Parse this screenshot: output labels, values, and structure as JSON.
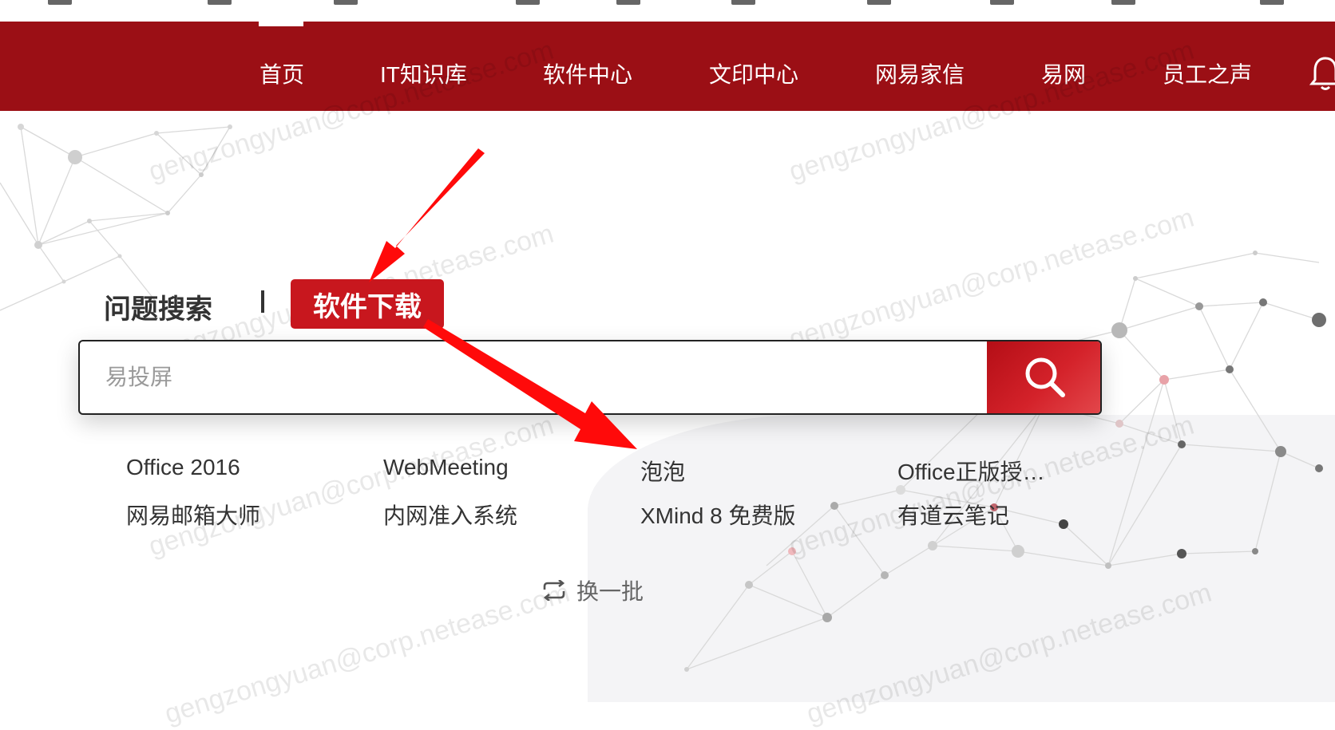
{
  "nav": {
    "items": [
      "首页",
      "IT知识库",
      "软件中心",
      "文印中心",
      "网易家信",
      "易网",
      "员工之声"
    ],
    "active_index": 0,
    "bg_color": "#9b0f15"
  },
  "watermark_text": "gengzongyuan@corp.netease.com",
  "search": {
    "tabs": {
      "question": "问题搜索",
      "software": "软件下载"
    },
    "active_tab": "software",
    "placeholder": "易投屏",
    "button_icon": "search-icon",
    "accent_color": "#c8171e"
  },
  "suggestions": [
    [
      "Office 2016",
      "WebMeeting",
      "泡泡",
      "Office正版授…"
    ],
    [
      "网易邮箱大师",
      "内网准入系统",
      "XMind 8 免费版",
      "有道云笔记"
    ]
  ],
  "refresh_label": "换一批",
  "icons": {
    "bell": "bell-icon",
    "refresh": "refresh-icon"
  }
}
